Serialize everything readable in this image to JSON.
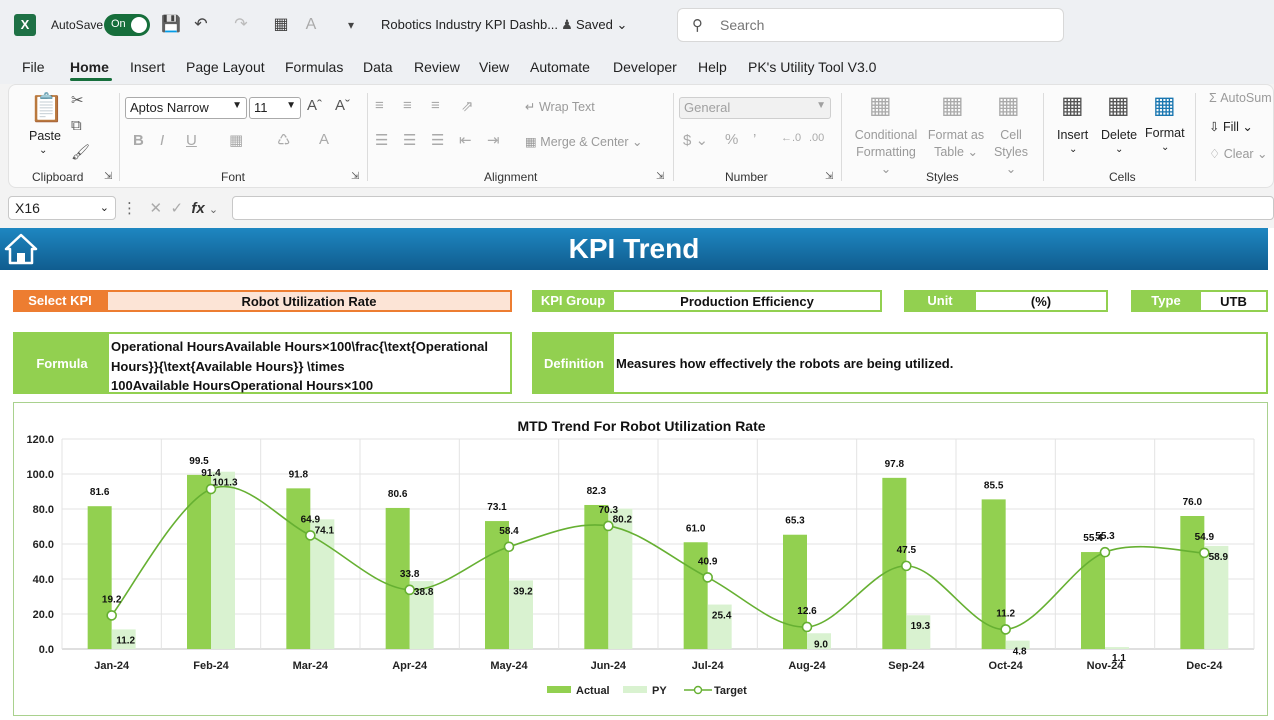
{
  "titlebar": {
    "app_icon": "X",
    "autosave_label": "AutoSave",
    "autosave_state": "On",
    "doc_title": "Robotics Industry KPI Dashb...",
    "saved_status": "Saved",
    "search_placeholder": "Search"
  },
  "menu": [
    "File",
    "Home",
    "Insert",
    "Page Layout",
    "Formulas",
    "Data",
    "Review",
    "View",
    "Automate",
    "Developer",
    "Help",
    "PK's Utility Tool V3.0"
  ],
  "ribbon": {
    "clipboard": {
      "label": "Clipboard",
      "paste": "Paste"
    },
    "font": {
      "label": "Font",
      "name": "Aptos Narrow",
      "size": "11",
      "bold": "B",
      "italic": "I",
      "underline": "U"
    },
    "alignment": {
      "label": "Alignment",
      "wrap": "Wrap Text",
      "merge": "Merge & Center"
    },
    "number": {
      "label": "Number",
      "format": "General"
    },
    "styles": {
      "label": "Styles",
      "conditional_1": "Conditional",
      "conditional_2": "Formatting",
      "format_table_1": "Format as",
      "format_table_2": "Table",
      "cell_styles_1": "Cell",
      "cell_styles_2": "Styles"
    },
    "cells": {
      "label": "Cells",
      "insert": "Insert",
      "delete": "Delete",
      "format": "Format"
    },
    "editing": {
      "autosum": "AutoSum",
      "fill": "Fill",
      "clear": "Clear"
    }
  },
  "formula_bar": {
    "name_box": "X16",
    "fx": "fx"
  },
  "dashboard": {
    "title": "KPI Trend",
    "select_kpi_label": "Select KPI",
    "select_kpi_value": "Robot Utilization Rate",
    "kpi_group_label": "KPI Group",
    "kpi_group_value": "Production Efficiency",
    "unit_label": "Unit",
    "unit_value": "(%)",
    "type_label": "Type",
    "type_value": "UTB",
    "formula_label": "Formula",
    "formula_line1": "Operational HoursAvailable Hours×100\\frac{\\text{Operational",
    "formula_line2": "Hours}}{\\text{Available Hours}} \\times",
    "formula_line3": "100Available HoursOperational Hours×100",
    "definition_label": "Definition",
    "definition_value": "Measures how effectively the robots are being utilized."
  },
  "colors": {
    "actual": "#92d050",
    "py": "#d9f2d0",
    "target": "#66b032",
    "orange": "#ed7d31",
    "banner": "#1976b0"
  },
  "chart_data": {
    "type": "bar",
    "title": "MTD Trend For Robot Utilization Rate",
    "categories": [
      "Jan-24",
      "Feb-24",
      "Mar-24",
      "Apr-24",
      "May-24",
      "Jun-24",
      "Jul-24",
      "Aug-24",
      "Sep-24",
      "Oct-24",
      "Nov-24",
      "Dec-24"
    ],
    "series": [
      {
        "name": "Actual",
        "type": "bar",
        "values": [
          81.6,
          99.5,
          91.8,
          80.6,
          73.1,
          82.3,
          61.0,
          65.3,
          97.8,
          85.5,
          55.4,
          76.0
        ]
      },
      {
        "name": "PY",
        "type": "bar",
        "values": [
          11.2,
          101.3,
          74.1,
          38.8,
          39.2,
          80.2,
          25.4,
          9.0,
          19.3,
          4.8,
          1.1,
          58.9
        ]
      },
      {
        "name": "Target",
        "type": "line",
        "values": [
          19.2,
          91.4,
          64.9,
          33.8,
          58.4,
          70.3,
          40.9,
          12.6,
          47.5,
          11.2,
          55.3,
          54.9
        ]
      }
    ],
    "yticks": [
      "0.0",
      "20.0",
      "40.0",
      "60.0",
      "80.0",
      "100.0",
      "120.0"
    ],
    "ylim": [
      0,
      120
    ],
    "grid": true,
    "legend": "bottom"
  }
}
